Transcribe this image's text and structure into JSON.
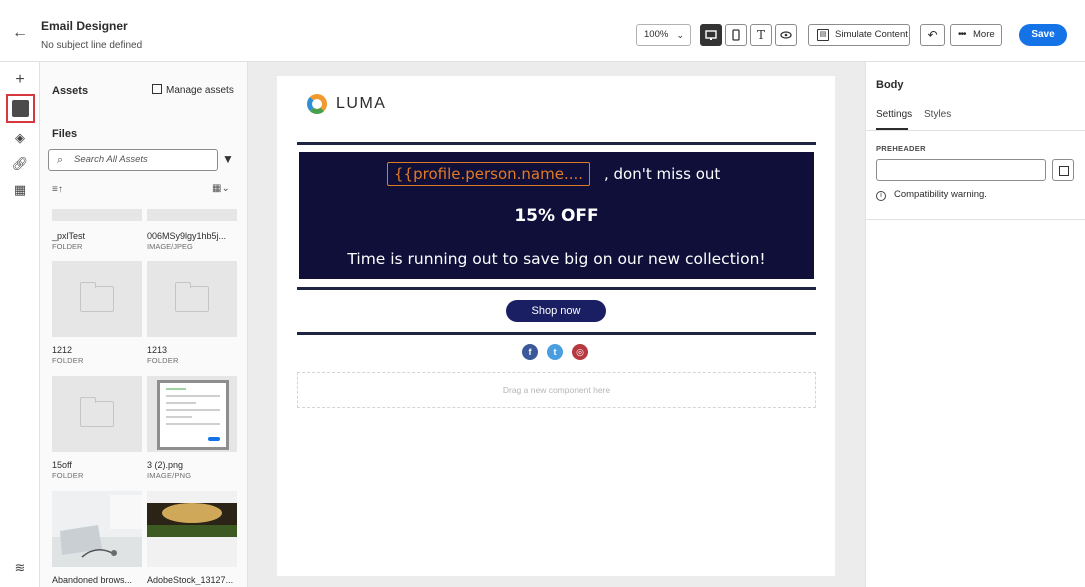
{
  "header": {
    "title": "Email Designer",
    "subtitle": "No subject line defined",
    "zoom": "100%",
    "simulate_label": "Simulate Content",
    "more_label": "More",
    "save_label": "Save"
  },
  "assets": {
    "title": "Assets",
    "manage_label": "Manage assets",
    "files_label": "Files",
    "search_placeholder": "Search All Assets",
    "items": [
      {
        "name": "_pxlTest",
        "type": "FOLDER"
      },
      {
        "name": "006MSy9lgy1hb5j...",
        "type": "IMAGE/JPEG"
      },
      {
        "name": "1212",
        "type": "FOLDER"
      },
      {
        "name": "1213",
        "type": "FOLDER"
      },
      {
        "name": "15off",
        "type": "FOLDER"
      },
      {
        "name": "3 (2).png",
        "type": "IMAGE/PNG"
      },
      {
        "name": "Abandoned brows...",
        "type": ""
      },
      {
        "name": "AdobeStock_13127...",
        "type": ""
      }
    ]
  },
  "email": {
    "brand": "LUMA",
    "token": "{{profile.person.name....",
    "token_suffix": ", don't miss out",
    "offer": "15% OFF",
    "tagline": "Time is running out to save big on our new collection!",
    "cta": "Shop now",
    "dropzone": "Drag a new component here"
  },
  "properties": {
    "title": "Body",
    "tabs": [
      "Settings",
      "Styles"
    ],
    "preheader_label": "PREHEADER",
    "preheader_value": "",
    "warning": "Compatibility warning."
  },
  "colors": {
    "accent": "#1473e6",
    "banner": "#0f0f3a",
    "token": "#e07a26",
    "cta": "#1a1f63",
    "selection": "#d7373f"
  }
}
